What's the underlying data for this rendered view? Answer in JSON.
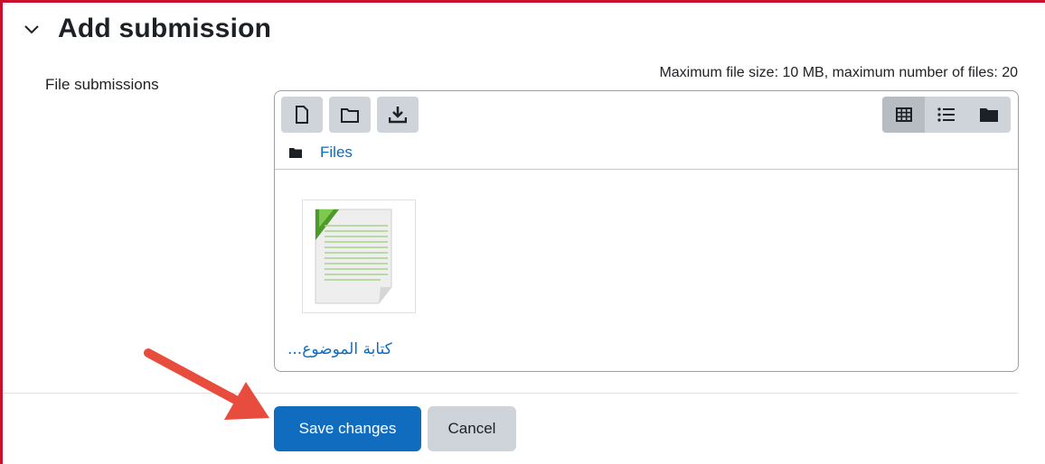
{
  "section": {
    "title": "Add submission",
    "toggle_icon": "chevron-down-icon"
  },
  "form": {
    "field_label": "File submissions",
    "limits_text": "Maximum file size: 10 MB, maximum number of files: 20"
  },
  "filemanager": {
    "toolbar": [
      {
        "icon": "add-file-icon"
      },
      {
        "icon": "create-folder-icon"
      },
      {
        "icon": "download-icon"
      }
    ],
    "views": [
      {
        "icon": "grid-view-icon",
        "active": true
      },
      {
        "icon": "list-view-icon",
        "active": false
      },
      {
        "icon": "tree-view-icon",
        "active": false
      }
    ],
    "breadcrumb": {
      "icon": "folder-icon",
      "label": "Files"
    },
    "files": [
      {
        "name": "كتابة الموضوع...",
        "icon": "document-icon"
      }
    ]
  },
  "actions": {
    "save_label": "Save changes",
    "cancel_label": "Cancel"
  },
  "colors": {
    "primary": "#0f6cbf",
    "secondary": "#ced4da",
    "frame": "#c8102e",
    "annotation_arrow": "#e74c3c"
  }
}
